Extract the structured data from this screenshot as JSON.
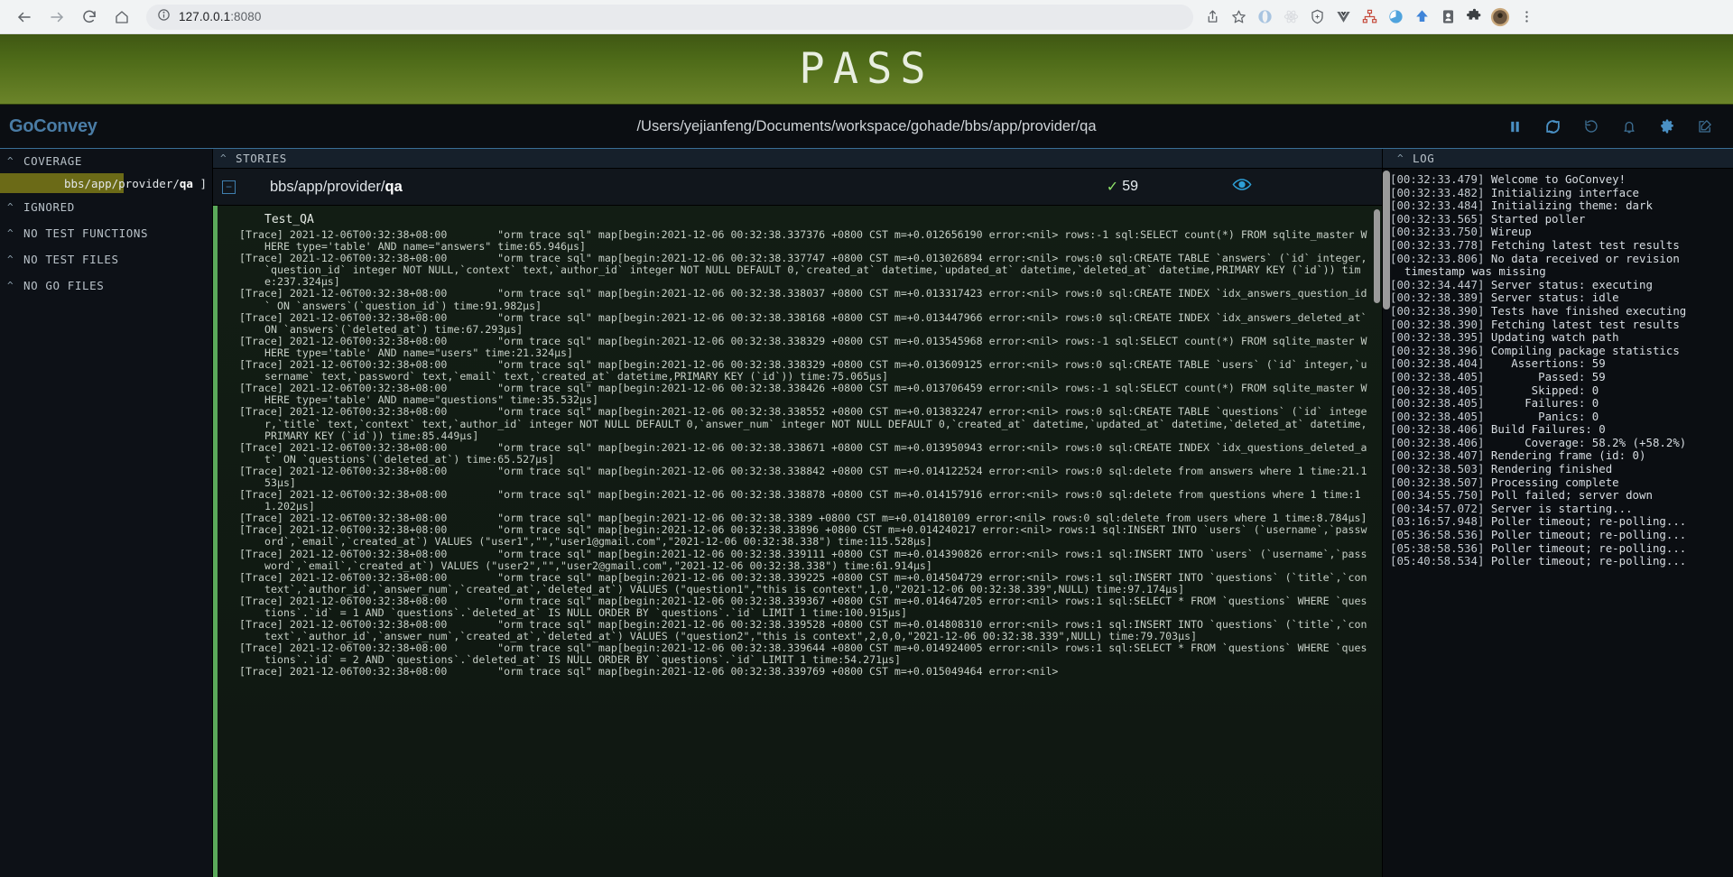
{
  "browser": {
    "back_icon": "back-arrow-icon",
    "forward_icon": "forward-arrow-icon",
    "reload_icon": "reload-icon",
    "home_icon": "home-icon",
    "site_info_icon": "site-info-icon",
    "url_main": "127.0.0.1",
    "url_port": ":8080",
    "url_full": "127.0.0.1:8080",
    "share_icon": "share-icon",
    "bookmark_icon": "star-icon",
    "extensions": [
      "opera-icon",
      "react-devtools-icon",
      "shield-icon",
      "vue-devtools-icon",
      "sitemap-icon",
      "clock-icon",
      "upload-icon",
      "reader-icon",
      "puzzle-extension-icon",
      "avatar",
      "kebab-menu-icon"
    ]
  },
  "banner": {
    "status": "PASS",
    "color": "#6b8429"
  },
  "header": {
    "logo": "GoConvey",
    "path": "/Users/yejianfeng/Documents/workspace/gohade/bbs/app/provider/qa",
    "icons": [
      "pause-icon",
      "refresh-icon",
      "history-icon",
      "bell-icon",
      "gear-icon",
      "compose-icon"
    ]
  },
  "sidebar": {
    "sections": [
      {
        "label": "COVERAGE",
        "caret": "chevron-up-icon"
      },
      {
        "label": "IGNORED",
        "caret": "chevron-up-icon"
      },
      {
        "label": "NO TEST FUNCTIONS",
        "caret": "chevron-up-icon"
      },
      {
        "label": "NO TEST FILES",
        "caret": "chevron-up-icon"
      },
      {
        "label": "NO GO FILES",
        "caret": "chevron-up-icon"
      }
    ],
    "coverage_items": [
      {
        "package": "bbs/app/provider/",
        "leaf": "qa",
        "suffix": "]",
        "percent": 58.2,
        "fill_color": "#6b6a17"
      }
    ]
  },
  "stories": {
    "panel_label": "STORIES",
    "caret": "chevron-up-icon",
    "collapse_glyph": "⊖",
    "package_prefix": "bbs/app/provider/",
    "package_leaf": "qa",
    "check_glyph": "✓",
    "assertions": "59",
    "eye_icon": "eye-icon",
    "test_name": "Test_QA",
    "trace_lines": [
      "[Trace] 2021-12-06T00:32:38+08:00        \"orm trace sql\" map[begin:2021-12-06 00:32:38.337376 +0800 CST m=+0.012656190 error:<nil> rows:-1 sql:SELECT count(*) FROM sqlite_master WHERE type='table' AND name=\"answers\" time:65.946µs]",
      "[Trace] 2021-12-06T00:32:38+08:00        \"orm trace sql\" map[begin:2021-12-06 00:32:38.337747 +0800 CST m=+0.013026894 error:<nil> rows:0 sql:CREATE TABLE `answers` (`id` integer,`question_id` integer NOT NULL,`context` text,`author_id` integer NOT NULL DEFAULT 0,`created_at` datetime,`updated_at` datetime,`deleted_at` datetime,PRIMARY KEY (`id`)) time:237.324µs]",
      "[Trace] 2021-12-06T00:32:38+08:00        \"orm trace sql\" map[begin:2021-12-06 00:32:38.338037 +0800 CST m=+0.013317423 error:<nil> rows:0 sql:CREATE INDEX `idx_answers_question_id` ON `answers`(`question_id`) time:91.982µs]",
      "[Trace] 2021-12-06T00:32:38+08:00        \"orm trace sql\" map[begin:2021-12-06 00:32:38.338168 +0800 CST m=+0.013447966 error:<nil> rows:0 sql:CREATE INDEX `idx_answers_deleted_at` ON `answers`(`deleted_at`) time:67.293µs]",
      "[Trace] 2021-12-06T00:32:38+08:00        \"orm trace sql\" map[begin:2021-12-06 00:32:38.338329 +0800 CST m=+0.013545968 error:<nil> rows:-1 sql:SELECT count(*) FROM sqlite_master WHERE type='table' AND name=\"users\" time:21.324µs]",
      "[Trace] 2021-12-06T00:32:38+08:00        \"orm trace sql\" map[begin:2021-12-06 00:32:38.338329 +0800 CST m=+0.013609125 error:<nil> rows:0 sql:CREATE TABLE `users` (`id` integer,`username` text,`password` text,`email` text,`created_at` datetime,PRIMARY KEY (`id`)) time:75.065µs]",
      "[Trace] 2021-12-06T00:32:38+08:00        \"orm trace sql\" map[begin:2021-12-06 00:32:38.338426 +0800 CST m=+0.013706459 error:<nil> rows:-1 sql:SELECT count(*) FROM sqlite_master WHERE type='table' AND name=\"questions\" time:35.532µs]",
      "[Trace] 2021-12-06T00:32:38+08:00        \"orm trace sql\" map[begin:2021-12-06 00:32:38.338552 +0800 CST m=+0.013832247 error:<nil> rows:0 sql:CREATE TABLE `questions` (`id` integer,`title` text,`context` text,`author_id` integer NOT NULL DEFAULT 0,`answer_num` integer NOT NULL DEFAULT 0,`created_at` datetime,`updated_at` datetime,`deleted_at` datetime,PRIMARY KEY (`id`)) time:85.449µs]",
      "[Trace] 2021-12-06T00:32:38+08:00        \"orm trace sql\" map[begin:2021-12-06 00:32:38.338671 +0800 CST m=+0.013950943 error:<nil> rows:0 sql:CREATE INDEX `idx_questions_deleted_at` ON `questions`(`deleted_at`) time:65.527µs]",
      "[Trace] 2021-12-06T00:32:38+08:00        \"orm trace sql\" map[begin:2021-12-06 00:32:38.338842 +0800 CST m=+0.014122524 error:<nil> rows:0 sql:delete from answers where 1 time:21.153µs]",
      "[Trace] 2021-12-06T00:32:38+08:00        \"orm trace sql\" map[begin:2021-12-06 00:32:38.338878 +0800 CST m=+0.014157916 error:<nil> rows:0 sql:delete from questions where 1 time:11.202µs]",
      "[Trace] 2021-12-06T00:32:38+08:00        \"orm trace sql\" map[begin:2021-12-06 00:32:38.3389 +0800 CST m=+0.014180109 error:<nil> rows:0 sql:delete from users where 1 time:8.784µs]",
      "[Trace] 2021-12-06T00:32:38+08:00        \"orm trace sql\" map[begin:2021-12-06 00:32:38.33896 +0800 CST m=+0.014240217 error:<nil> rows:1 sql:INSERT INTO `users` (`username`,`password`,`email`,`created_at`) VALUES (\"user1\",\"\",\"user1@gmail.com\",\"2021-12-06 00:32:38.338\") time:115.528µs]",
      "[Trace] 2021-12-06T00:32:38+08:00        \"orm trace sql\" map[begin:2021-12-06 00:32:38.339111 +0800 CST m=+0.014390826 error:<nil> rows:1 sql:INSERT INTO `users` (`username`,`password`,`email`,`created_at`) VALUES (\"user2\",\"\",\"user2@gmail.com\",\"2021-12-06 00:32:38.338\") time:61.914µs]",
      "[Trace] 2021-12-06T00:32:38+08:00        \"orm trace sql\" map[begin:2021-12-06 00:32:38.339225 +0800 CST m=+0.014504729 error:<nil> rows:1 sql:INSERT INTO `questions` (`title`,`context`,`author_id`,`answer_num`,`created_at`,`deleted_at`) VALUES (\"question1\",\"this is context\",1,0,\"2021-12-06 00:32:38.339\",NULL) time:97.174µs]",
      "[Trace] 2021-12-06T00:32:38+08:00        \"orm trace sql\" map[begin:2021-12-06 00:32:38.339367 +0800 CST m=+0.014647205 error:<nil> rows:1 sql:SELECT * FROM `questions` WHERE `questions`.`id` = 1 AND `questions`.`deleted_at` IS NULL ORDER BY `questions`.`id` LIMIT 1 time:100.915µs]",
      "[Trace] 2021-12-06T00:32:38+08:00        \"orm trace sql\" map[begin:2021-12-06 00:32:38.339528 +0800 CST m=+0.014808310 error:<nil> rows:1 sql:INSERT INTO `questions` (`title`,`context`,`author_id`,`answer_num`,`created_at`,`deleted_at`) VALUES (\"question2\",\"this is context\",2,0,0,\"2021-12-06 00:32:38.339\",NULL) time:79.703µs]",
      "[Trace] 2021-12-06T00:32:38+08:00        \"orm trace sql\" map[begin:2021-12-06 00:32:38.339644 +0800 CST m=+0.014924005 error:<nil> rows:1 sql:SELECT * FROM `questions` WHERE `questions`.`id` = 2 AND `questions`.`deleted_at` IS NULL ORDER BY `questions`.`id` LIMIT 1 time:54.271µs]",
      "[Trace] 2021-12-06T00:32:38+08:00        \"orm trace sql\" map[begin:2021-12-06 00:32:38.339769 +0800 CST m=+0.015049464 error:<nil>"
    ]
  },
  "log": {
    "panel_label": "LOG",
    "caret": "chevron-up-icon",
    "lines": [
      {
        "ts": "[00:32:33.479]",
        "msg": "Welcome to GoConvey!"
      },
      {
        "ts": "[00:32:33.482]",
        "msg": "Initializing interface"
      },
      {
        "ts": "[00:32:33.484]",
        "msg": "Initializing theme: dark"
      },
      {
        "ts": "[00:32:33.565]",
        "msg": "Started poller"
      },
      {
        "ts": "[00:32:33.750]",
        "msg": "Wireup"
      },
      {
        "ts": "[00:32:33.778]",
        "msg": "Fetching latest test results"
      },
      {
        "ts": "[00:32:33.806]",
        "msg": "No data received or revision timestamp was missing"
      },
      {
        "ts": "[00:32:34.447]",
        "msg": "Server status: executing"
      },
      {
        "ts": "[00:32:38.389]",
        "msg": "Server status: idle"
      },
      {
        "ts": "[00:32:38.390]",
        "msg": "Tests have finished executing"
      },
      {
        "ts": "[00:32:38.390]",
        "msg": "Fetching latest test results"
      },
      {
        "ts": "[00:32:38.395]",
        "msg": "Updating watch path"
      },
      {
        "ts": "[00:32:38.396]",
        "msg": "Compiling package statistics"
      },
      {
        "ts": "[00:32:38.404]",
        "msg": "   Assertions: 59"
      },
      {
        "ts": "[00:32:38.405]",
        "msg": "       Passed: 59"
      },
      {
        "ts": "[00:32:38.405]",
        "msg": "      Skipped: 0"
      },
      {
        "ts": "[00:32:38.405]",
        "msg": "     Failures: 0"
      },
      {
        "ts": "[00:32:38.405]",
        "msg": "       Panics: 0"
      },
      {
        "ts": "[00:32:38.406]",
        "msg": "Build Failures: 0"
      },
      {
        "ts": "[00:32:38.406]",
        "msg": "     Coverage: 58.2% (+58.2%)"
      },
      {
        "ts": "[00:32:38.407]",
        "msg": "Rendering frame (id: 0)"
      },
      {
        "ts": "[00:32:38.503]",
        "msg": "Rendering finished"
      },
      {
        "ts": "[00:32:38.507]",
        "msg": "Processing complete"
      },
      {
        "ts": "[00:34:55.750]",
        "msg": "Poll failed; server down"
      },
      {
        "ts": "[00:34:57.072]",
        "msg": "Server is starting..."
      },
      {
        "ts": "[03:16:57.948]",
        "msg": "Poller timeout; re-polling..."
      },
      {
        "ts": "[05:36:58.536]",
        "msg": "Poller timeout; re-polling..."
      },
      {
        "ts": "[05:38:58.536]",
        "msg": "Poller timeout; re-polling..."
      },
      {
        "ts": "[05:40:58.534]",
        "msg": "Poller timeout; re-polling..."
      }
    ]
  }
}
